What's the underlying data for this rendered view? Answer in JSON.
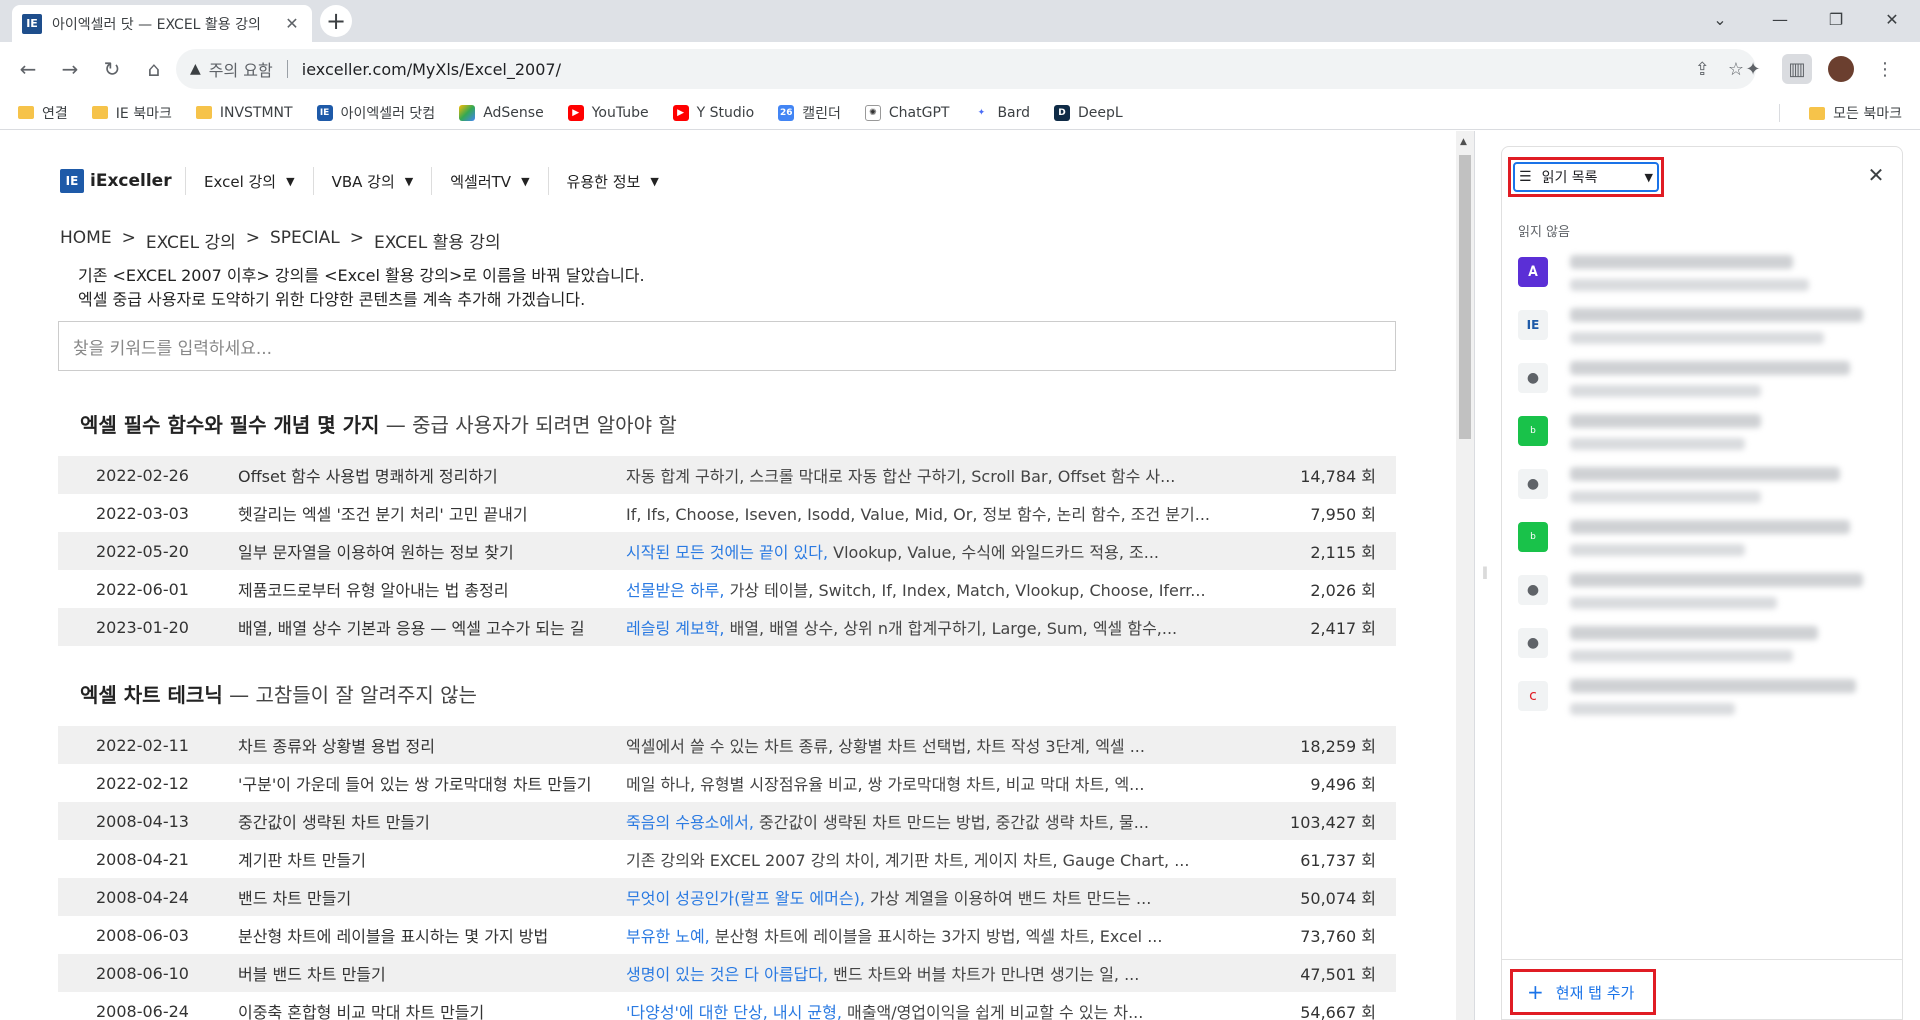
{
  "browser": {
    "tab_title": "아이엑셀러 닷 — EXCEL 활용 강의",
    "tab_favicon": "IE",
    "url_warning": "주의 요함",
    "url": "iexceller.com/MyXls/Excel_2007/"
  },
  "bookmarks": [
    {
      "label": "연결",
      "icon": "folder-icon"
    },
    {
      "label": "IE 북마크",
      "icon": "folder-icon"
    },
    {
      "label": "INVSTMNT",
      "icon": "folder-icon"
    },
    {
      "label": "아이엑셀러 닷컴",
      "icon": "iexceller-icon"
    },
    {
      "label": "AdSense",
      "icon": "adsense-icon"
    },
    {
      "label": "YouTube",
      "icon": "youtube-icon"
    },
    {
      "label": "Y Studio",
      "icon": "youtube-studio-icon"
    },
    {
      "label": "캘린더",
      "icon": "calendar-icon"
    },
    {
      "label": "ChatGPT",
      "icon": "chatgpt-icon"
    },
    {
      "label": "Bard",
      "icon": "bard-icon"
    },
    {
      "label": "DeepL",
      "icon": "deepl-icon"
    }
  ],
  "all_bookmarks_label": "모든 북마크",
  "site": {
    "logo": "iExceller",
    "logo_icon": "IE",
    "menu": [
      "Excel 강의",
      "VBA 강의",
      "엑셀러TV",
      "유용한 정보"
    ],
    "breadcrumb": [
      "HOME",
      ">",
      "EXCEL 강의",
      ">",
      "SPECIAL",
      ">",
      "EXCEL 활용 강의"
    ],
    "intro_line1": "기존 <EXCEL 2007 이후> 강의를 <Excel 활용 강의>로 이름을 바꿔 달았습니다.",
    "intro_line2": "엑셀 중급 사용자로 도약하기 위한 다양한 콘텐츠를 계속 추가해 가겠습니다.",
    "search_placeholder": "찾을 키워드를 입력하세요..."
  },
  "sections": [
    {
      "title": "엑셀 필수 함수와 필수 개념 몇 가지",
      "subtitle": "— 중급 사용자가 되려면 알아야 할",
      "rows": [
        {
          "date": "2022-02-26",
          "title": "Offset 함수 사용법 명쾌하게 정리하기",
          "link": "",
          "desc": "자동 합계 구하기, 스크롤 막대로 자동 합산 구하기, Scroll Bar, Offset 함수 사...",
          "count": "14,784 회"
        },
        {
          "date": "2022-03-03",
          "title": "헷갈리는 엑셀 '조건 분기 처리' 고민 끝내기",
          "link": "",
          "desc": "If, Ifs, Choose, Iseven, Isodd, Value, Mid, Or, 정보 함수, 논리 함수, 조건 분기...",
          "count": "7,950 회"
        },
        {
          "date": "2022-05-20",
          "title": "일부 문자열을 이용하여 원하는 정보 찾기",
          "link": "시작된 모든 것에는 끝이 있다,",
          "desc": " Vlookup, Value, 수식에 와일드카드 적용, 조...",
          "count": "2,115 회"
        },
        {
          "date": "2022-06-01",
          "title": "제품코드로부터 유형 알아내는 법 총정리",
          "link": "선물받은 하루,",
          "desc": " 가상 테이블, Switch, If, Index, Match, Vlookup, Choose, Iferr...",
          "count": "2,026 회"
        },
        {
          "date": "2023-01-20",
          "title": "배열, 배열 상수 기본과 응용 — 엑셀 고수가 되는 길",
          "link": "레슬링 계보학,",
          "desc": " 배열, 배열 상수, 상위 n개 합계구하기, Large, Sum, 엑셀 함수,...",
          "count": "2,417 회"
        }
      ]
    },
    {
      "title": "엑셀 차트 테크닉",
      "subtitle": "— 고참들이 잘 알려주지 않는",
      "rows": [
        {
          "date": "2022-02-11",
          "title": "차트 종류와 상황별 용법 정리",
          "link": "",
          "desc": "엑셀에서 쓸 수 있는 차트 종류, 상황별 차트 선택법, 차트 작성 3단계, 엑셀 ...",
          "count": "18,259 회"
        },
        {
          "date": "2022-02-12",
          "title": "'구분'이 가운데 들어 있는 쌍 가로막대형 차트 만들기",
          "link": "",
          "desc": "메일 하나, 유형별 시장점유율 비교, 쌍 가로막대형 차트, 비교 막대 차트, 엑...",
          "count": "9,496 회"
        },
        {
          "date": "2008-04-13",
          "title": "중간값이 생략된 차트 만들기",
          "link": "죽음의 수용소에서,",
          "desc": " 중간값이 생략된 차트 만드는 방법, 중간값 생략 차트, 물...",
          "count": "103,427 회"
        },
        {
          "date": "2008-04-21",
          "title": "계기판 차트 만들기",
          "link": "",
          "desc": "기존 강의와 EXCEL 2007 강의 차이, 계기판 차트, 게이지 차트, Gauge Chart, ...",
          "count": "61,737 회"
        },
        {
          "date": "2008-04-24",
          "title": "밴드 차트 만들기",
          "link": "무엇이 성공인가(랄프 왈도 에머슨),",
          "desc": " 가상 계열을 이용하여 밴드 차트 만드는 ...",
          "count": "50,074 회"
        },
        {
          "date": "2008-06-03",
          "title": "분산형 차트에 레이블을 표시하는 몇 가지 방법",
          "link": "부유한 노예,",
          "desc": " 분산형 차트에 레이블을 표시하는 3가지 방법, 엑셀 차트, Excel ...",
          "count": "73,760 회"
        },
        {
          "date": "2008-06-10",
          "title": "버블 밴드 차트 만들기",
          "link": "생명이 있는 것은 다 아름답다,",
          "desc": " 밴드 차트와 버블 차트가 만나면 생기는 일, ...",
          "count": "47,501 회"
        },
        {
          "date": "2008-06-24",
          "title": "이중축 혼합형 비교 막대 차트 만들기",
          "link": "'다양성'에 대한 단상, 내시 균형,",
          "desc": " 매출액/영업이익을 쉽게 비교할 수 있는 차...",
          "count": "54,667 회"
        }
      ]
    }
  ],
  "side_panel": {
    "selector_label": "읽기 목록",
    "section_label": "읽지 않음",
    "add_label": "현재 탭 추가",
    "items": [
      {
        "icon": "ai-app-icon",
        "color": "#5b2fd6"
      },
      {
        "icon": "iexceller-icon",
        "color": "#1e5aa8"
      },
      {
        "icon": "globe-icon",
        "color": "#5f6368"
      },
      {
        "icon": "blog-icon",
        "color": "#19c24a"
      },
      {
        "icon": "globe-icon",
        "color": "#5f6368"
      },
      {
        "icon": "blog-icon",
        "color": "#19c24a"
      },
      {
        "icon": "globe-icon",
        "color": "#5f6368"
      },
      {
        "icon": "globe-icon",
        "color": "#5f6368"
      },
      {
        "icon": "swirl-icon",
        "color": "#e01c24"
      }
    ]
  }
}
